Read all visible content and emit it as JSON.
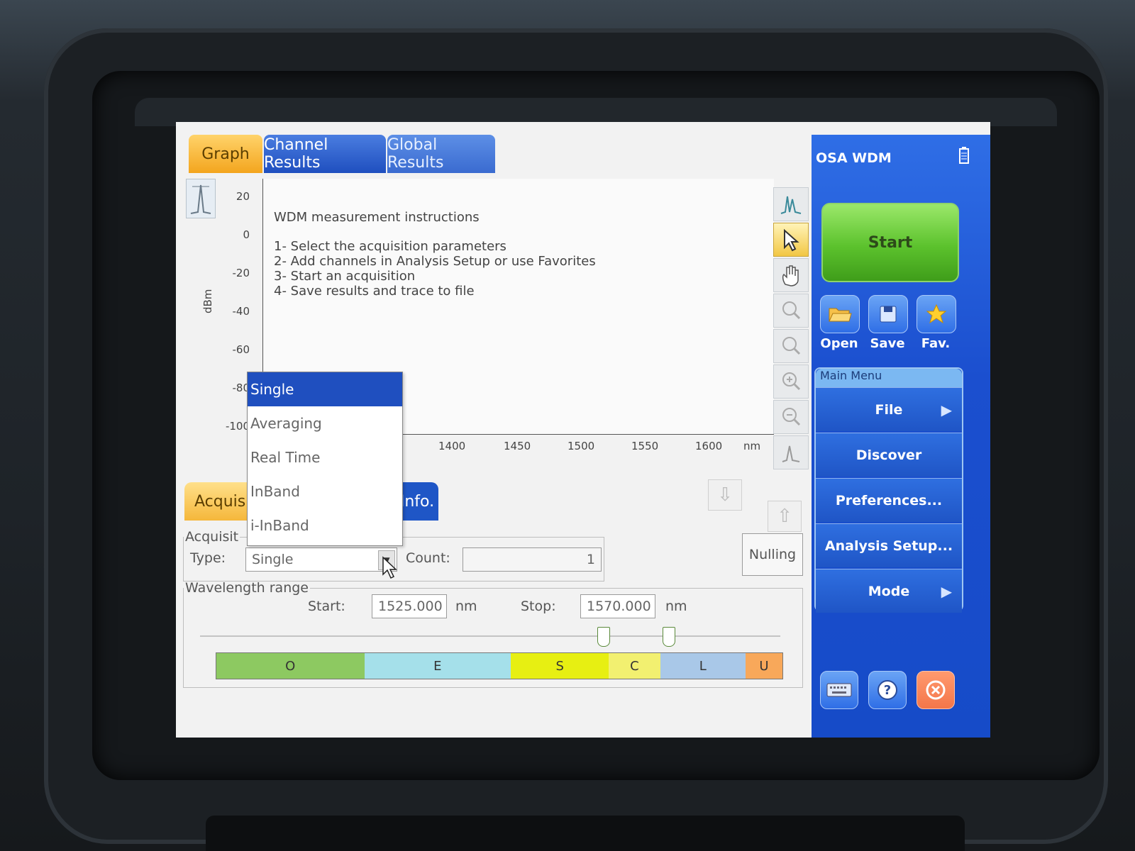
{
  "tabs": {
    "graph": "Graph",
    "channel_results": "Channel Results",
    "global_results": "Global Results"
  },
  "graph": {
    "y_unit": "dBm",
    "y_ticks": [
      "20",
      "0",
      "-20",
      "-40",
      "-60",
      "-80",
      "-100"
    ],
    "x_ticks": [
      "1400",
      "1450",
      "1500",
      "1550",
      "1600"
    ],
    "x_unit": "nm",
    "instructions_title": "WDM measurement instructions",
    "instructions": [
      "1- Select the acquisition parameters",
      "2- Add channels in Analysis Setup or use Favorites",
      "3- Start an acquisition",
      "4- Save results and trace to file"
    ]
  },
  "lower_tabs": {
    "acquisition": "Acquisit",
    "info": "Info."
  },
  "acquisition": {
    "legend": "Acquisit",
    "type_label": "Type:",
    "type_value": "Single",
    "count_label": "Count:",
    "count_value": "1",
    "nulling_label": "Nulling"
  },
  "dropdown": {
    "options": [
      "Single",
      "Averaging",
      "Real Time",
      "InBand",
      "i-InBand"
    ],
    "selected": "Single"
  },
  "wavelength": {
    "legend": "Wavelength range",
    "start_label": "Start:",
    "start_value": "1525.000",
    "stop_label": "Stop:",
    "stop_value": "1570.000",
    "unit": "nm"
  },
  "bands": [
    {
      "label": "O",
      "color": "#8dc961",
      "flex": 208
    },
    {
      "label": "E",
      "color": "#a5e0ea",
      "flex": 206
    },
    {
      "label": "S",
      "color": "#e7ef12",
      "flex": 138
    },
    {
      "label": "C",
      "color": "#f2f070",
      "flex": 72
    },
    {
      "label": "L",
      "color": "#a9c8e8",
      "flex": 120
    },
    {
      "label": "U",
      "color": "#f8a85a",
      "flex": 52
    }
  ],
  "sidebar": {
    "title": "OSA WDM",
    "start_label": "Start",
    "open_label": "Open",
    "save_label": "Save",
    "fav_label": "Fav.",
    "menu_header": "Main Menu",
    "menu_items": [
      "File",
      "Discover",
      "Preferences...",
      "Analysis Setup...",
      "Mode"
    ]
  },
  "colors": {
    "accent_blue": "#1f4fbf",
    "start_green": "#5cc22d",
    "close_orange": "#f4764a"
  }
}
